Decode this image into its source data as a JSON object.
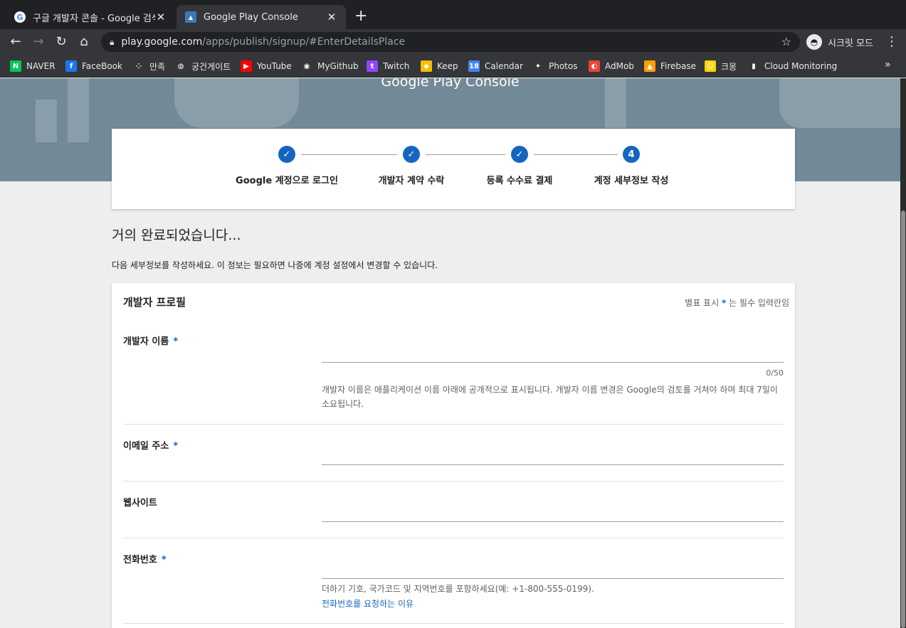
{
  "browser": {
    "tabs": [
      {
        "title": "구글 개발자 콘솔 - Google 검색",
        "favicon": "google-icon"
      },
      {
        "title": "Google Play Console",
        "favicon": "play-console-icon"
      }
    ],
    "new_tab": "+",
    "url_host": "play.google.com",
    "url_path": "/apps/publish/signup/#EnterDetailsPlace",
    "profile_label": "시크릿 모드",
    "bookmarks": [
      {
        "label": "NAVER",
        "icon": "naver-icon",
        "color": "#03c75a",
        "glyph": "N"
      },
      {
        "label": "FaceBook",
        "icon": "facebook-icon",
        "color": "#1877f2",
        "glyph": "f"
      },
      {
        "label": "만족",
        "icon": "dots-icon",
        "color": "#35363a",
        "glyph": "⁘"
      },
      {
        "label": "궁건게이트",
        "icon": "globe-icon",
        "color": "#35363a",
        "glyph": "◍"
      },
      {
        "label": "YouTube",
        "icon": "youtube-icon",
        "color": "#ff0000",
        "glyph": "▶"
      },
      {
        "label": "MyGithub",
        "icon": "github-icon",
        "color": "#35363a",
        "glyph": "◉"
      },
      {
        "label": "Twitch",
        "icon": "twitch-icon",
        "color": "#9146ff",
        "glyph": "t"
      },
      {
        "label": "Keep",
        "icon": "keep-icon",
        "color": "#fbbc04",
        "glyph": "◆"
      },
      {
        "label": "Calendar",
        "icon": "calendar-icon",
        "color": "#4285f4",
        "glyph": "18"
      },
      {
        "label": "Photos",
        "icon": "photos-icon",
        "color": "#35363a",
        "glyph": "✦"
      },
      {
        "label": "AdMob",
        "icon": "admob-icon",
        "color": "#ea4335",
        "glyph": "◐"
      },
      {
        "label": "Firebase",
        "icon": "firebase-icon",
        "color": "#ffa000",
        "glyph": "▲"
      },
      {
        "label": "크몽",
        "icon": "kmong-icon",
        "color": "#ffd400",
        "glyph": "☺"
      },
      {
        "label": "Cloud Monitoring",
        "icon": "monitoring-icon",
        "color": "#35363a",
        "glyph": "▮"
      }
    ],
    "more": "»"
  },
  "banner": {
    "title": "Google Play Console"
  },
  "steps": [
    {
      "label": "Google 계정으로 로그인",
      "done": true,
      "marker": "✓"
    },
    {
      "label": "개발자 계약 수락",
      "done": true,
      "marker": "✓"
    },
    {
      "label": "등록 수수료 결제",
      "done": true,
      "marker": "✓"
    },
    {
      "label": "계정 세부정보 작성",
      "done": false,
      "marker": "4"
    }
  ],
  "main": {
    "heading": "거의 완료되었습니다...",
    "intro": "다음 세부정보를 작성하세요. 이 정보는 필요하면 나중에 계정 설정에서 변경할 수 있습니다."
  },
  "card": {
    "title": "개발자 프로필",
    "required_note_prefix": "별표 표시",
    "required_note_suffix": "는 필수 입력란임",
    "asterisk": "*",
    "fields": {
      "developer_name": {
        "label": "개발자 이름",
        "value": "",
        "counter": "0/50",
        "help": "개발자 이름은 애플리케이션 이름 아래에 공개적으로 표시됩니다. 개발자 이름 변경은 Google의 검토를 거쳐야 하며 최대 7일이 소요됩니다."
      },
      "email": {
        "label": "이메일 주소",
        "value": ""
      },
      "website": {
        "label": "웹사이트",
        "value": ""
      },
      "phone": {
        "label": "전화번호",
        "value": "",
        "help": "더하기 기호, 국가코드 및 지역번호를 포함하세요(예: +1-800-555-0199).",
        "link": "전화번호를 요청하는 이유"
      }
    }
  }
}
